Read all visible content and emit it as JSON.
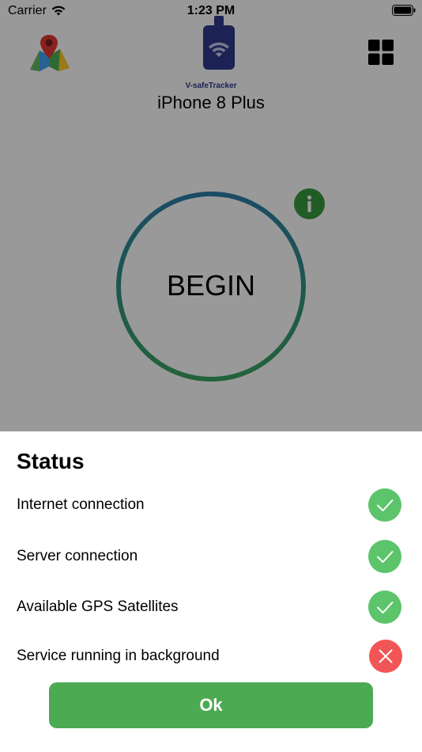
{
  "status_bar": {
    "carrier": "Carrier",
    "time": "1:23 PM"
  },
  "header": {
    "app_name": "V-safeTracker",
    "device_name": "iPhone 8 Plus",
    "map_icon": "map-pin-icon",
    "grid_icon": "grid-menu-icon"
  },
  "main": {
    "begin_label": "BEGIN",
    "info_icon": "info-icon"
  },
  "status_sheet": {
    "title": "Status",
    "items": [
      {
        "label": "Internet connection",
        "state": "ok"
      },
      {
        "label": "Server connection",
        "state": "ok"
      },
      {
        "label": "Available GPS Satellites",
        "state": "ok"
      },
      {
        "label": "Service running in background",
        "state": "error"
      }
    ],
    "ok_label": "Ok"
  },
  "colors": {
    "success": "#5cc46a",
    "error": "#f25555",
    "button": "#4caa52",
    "ring_start": "#1a4f6e",
    "ring_end": "#1f6b3a"
  }
}
